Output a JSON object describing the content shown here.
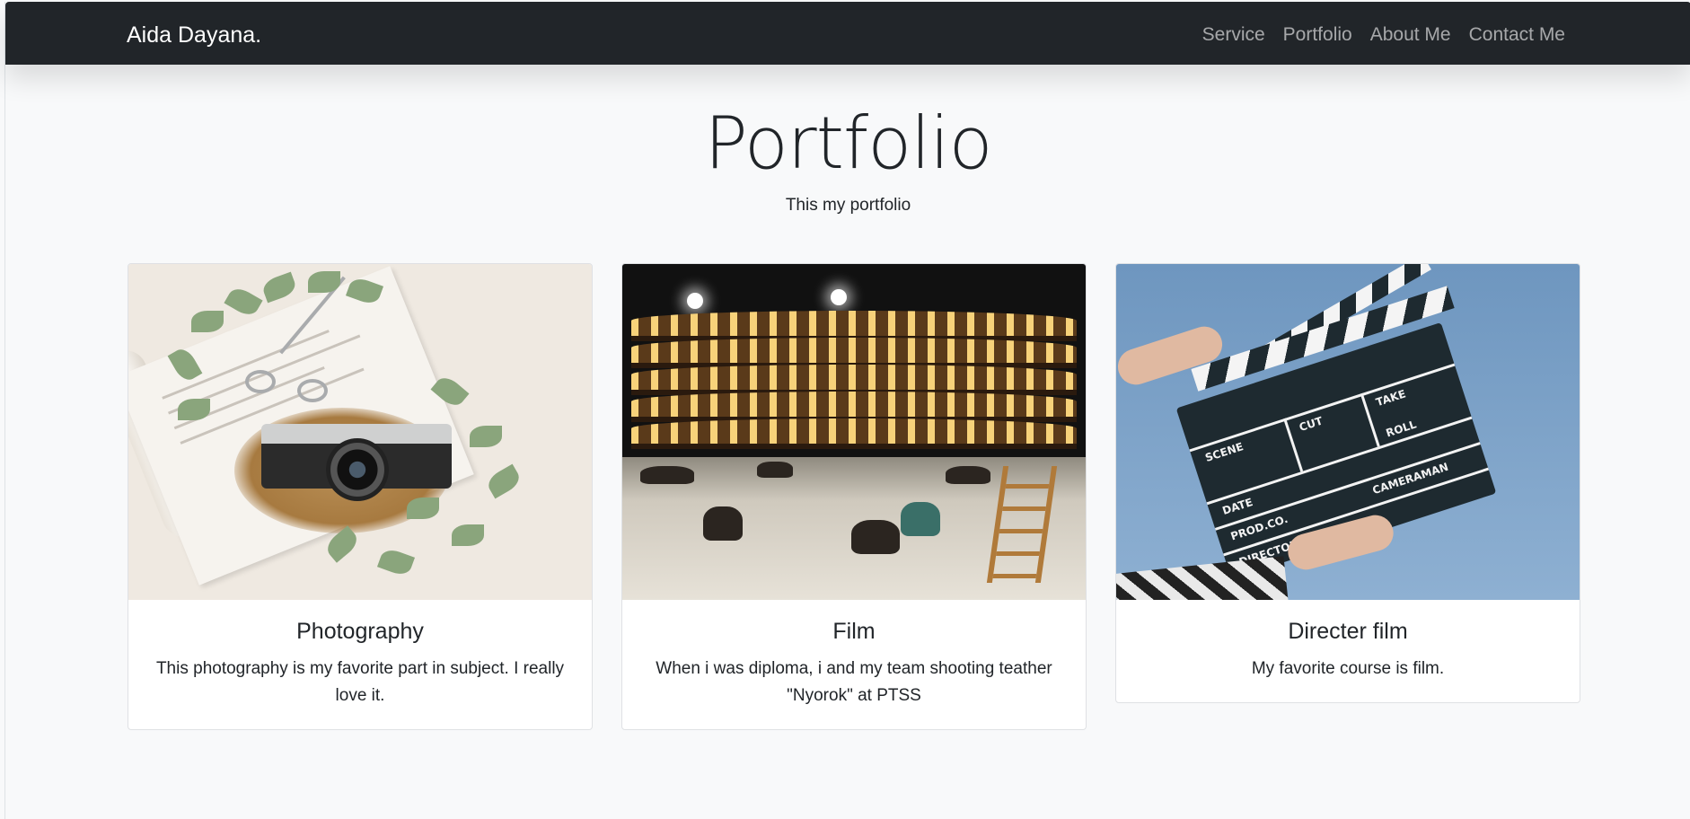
{
  "navbar": {
    "brand": "Aida Dayana.",
    "links": [
      "Service",
      "Portfolio",
      "About Me",
      "Contact Me"
    ]
  },
  "section": {
    "title": "Portfolio",
    "lead": "This my portfolio"
  },
  "cards": [
    {
      "title": "Photography",
      "text": "This photography is my favorite part in subject. I really love it."
    },
    {
      "title": "Film",
      "text": "When i was diploma, i and my team shooting teather \"Nyorok\" at PTSS"
    },
    {
      "title": "Directer film",
      "text": "My favorite course is film."
    }
  ],
  "clapperboard": {
    "scene_label": "SCENE",
    "cut_label": "CUT",
    "take_label": "TAKE",
    "roll_label": "ROLL",
    "date_label": "DATE",
    "prod_label": "PROD.CO.",
    "director_label": "DIRECTOR",
    "cameraman_label": "CAMERAMAN"
  }
}
